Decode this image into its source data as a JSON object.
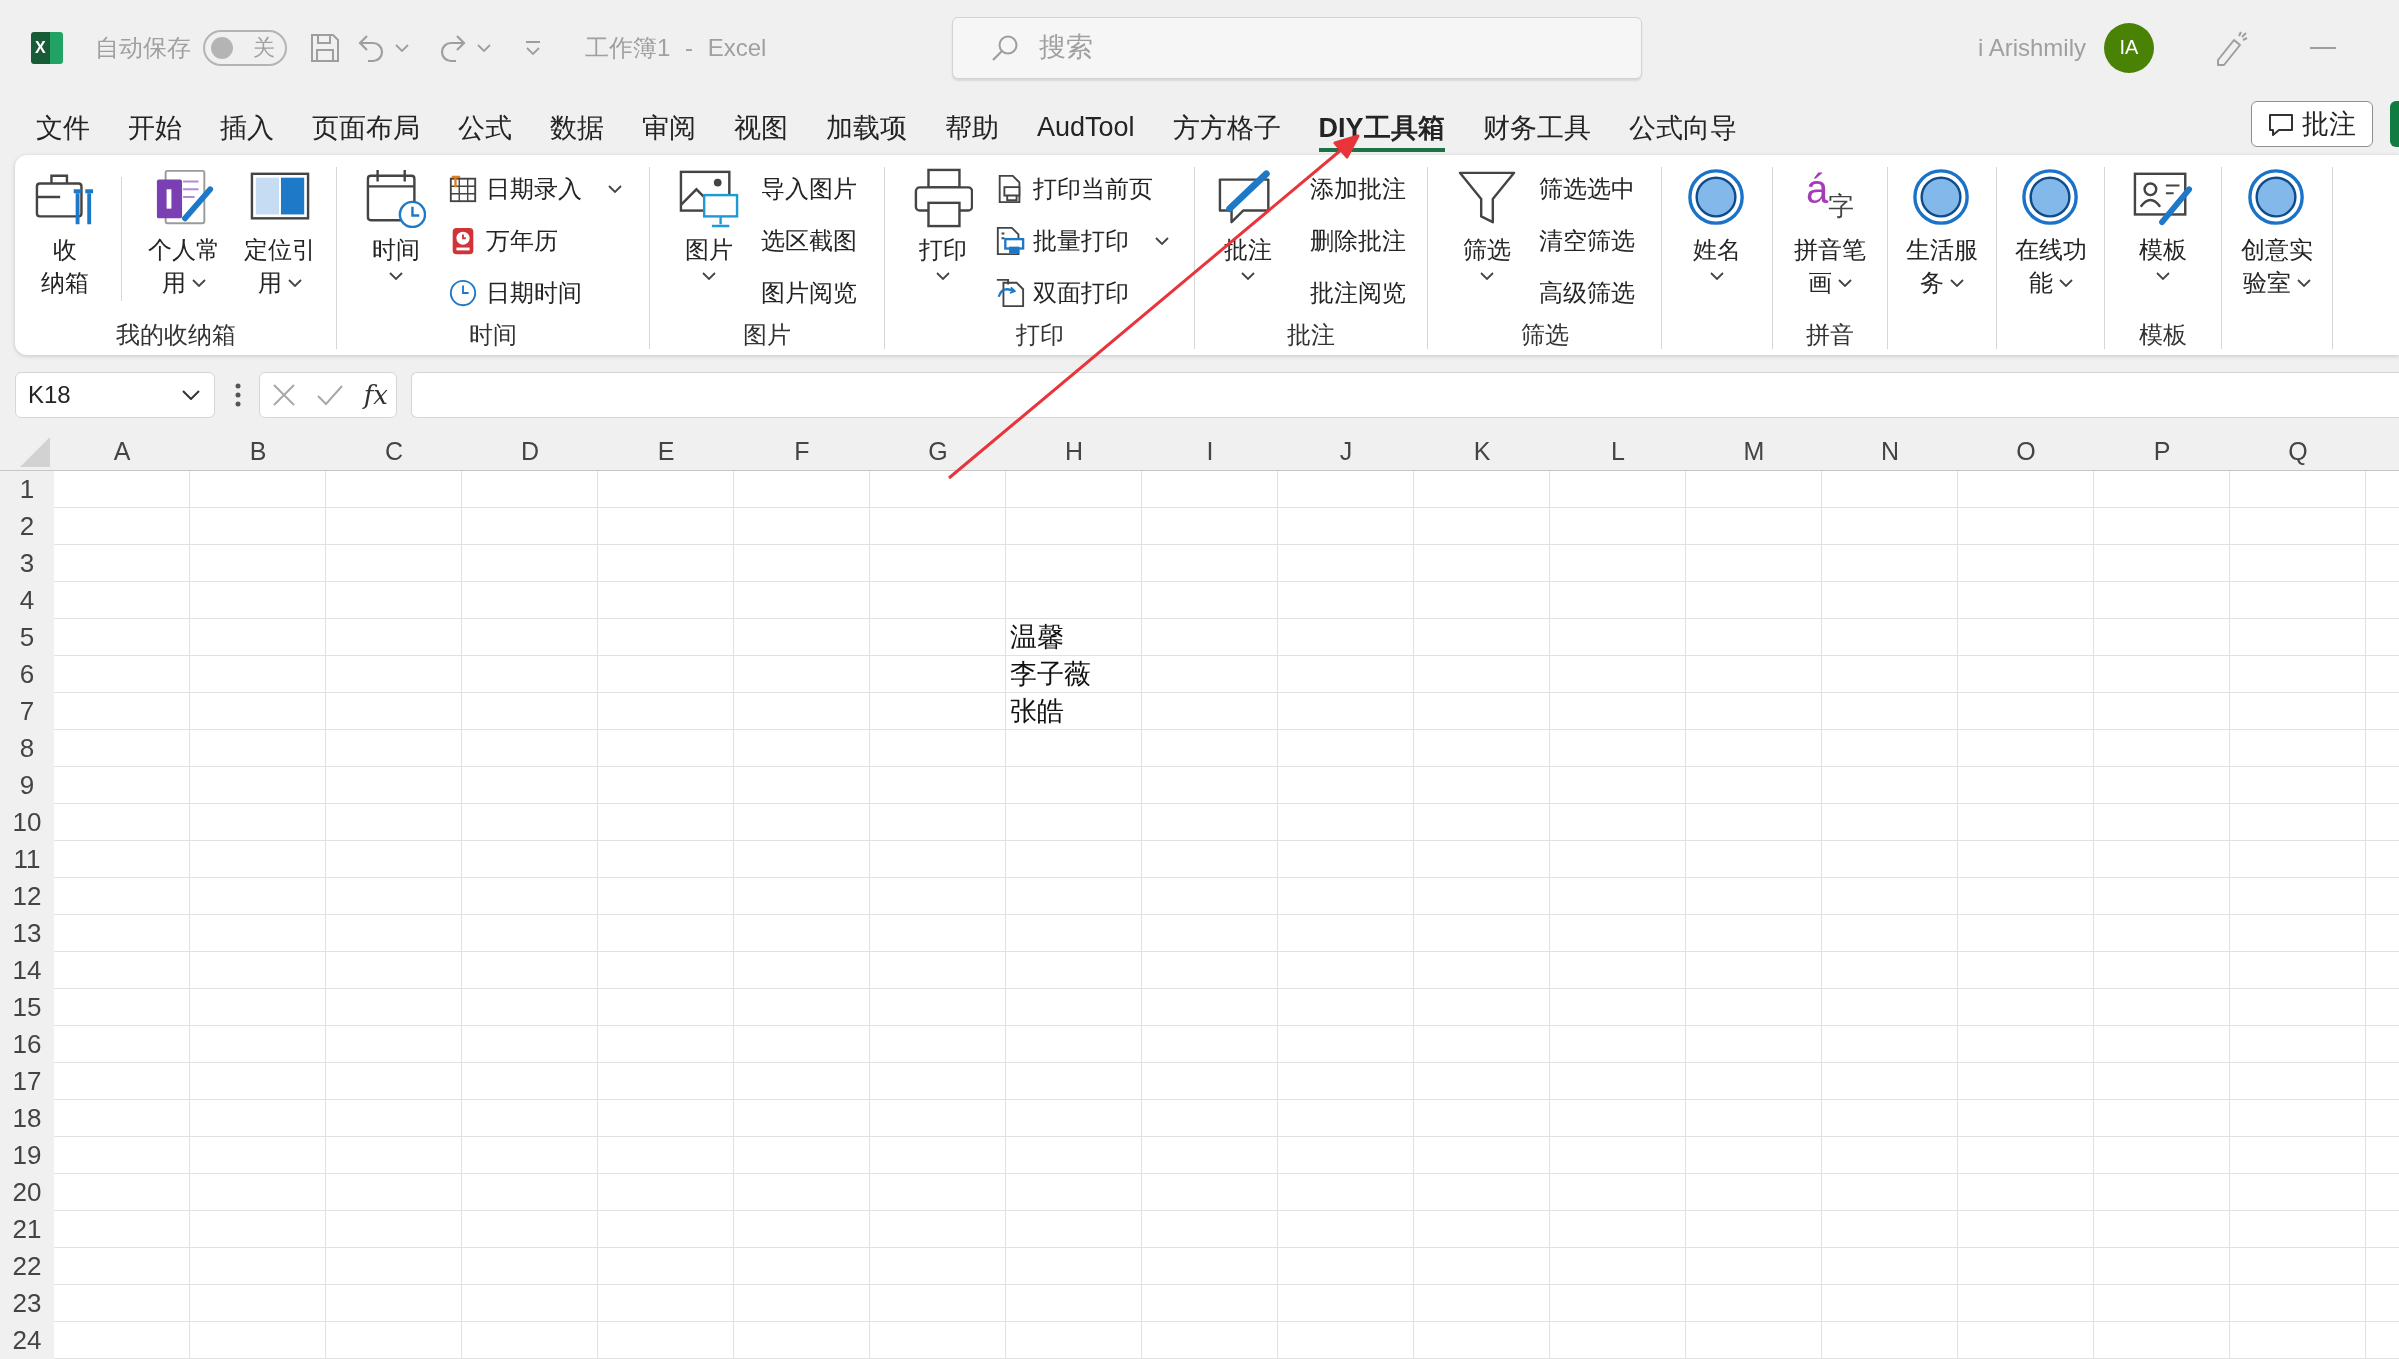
{
  "title_bar": {
    "logo": "X",
    "autosave": {
      "label": "自动保存",
      "state_label": "关",
      "on": false
    },
    "document_title": "工作簿1 - Excel",
    "search": {
      "placeholder": "搜索"
    },
    "user_name": "i Arishmily",
    "avatar_initials": "IA"
  },
  "ribbon_tabs": [
    {
      "label": "文件",
      "selected": false
    },
    {
      "label": "开始",
      "selected": false
    },
    {
      "label": "插入",
      "selected": false
    },
    {
      "label": "页面布局",
      "selected": false
    },
    {
      "label": "公式",
      "selected": false
    },
    {
      "label": "数据",
      "selected": false
    },
    {
      "label": "审阅",
      "selected": false
    },
    {
      "label": "视图",
      "selected": false
    },
    {
      "label": "加载项",
      "selected": false
    },
    {
      "label": "帮助",
      "selected": false
    },
    {
      "label": "AudTool",
      "selected": false
    },
    {
      "label": "方方格子",
      "selected": false
    },
    {
      "label": "DIY工具箱",
      "selected": true
    },
    {
      "label": "财务工具",
      "selected": false
    },
    {
      "label": "公式向导",
      "selected": false
    }
  ],
  "comments_button": {
    "label": "批注"
  },
  "ribbon_groups": [
    {
      "label": "我的收纳箱",
      "items": [
        {
          "kind": "large",
          "label": "收纳箱",
          "dropdown": false
        },
        {
          "kind": "separator"
        },
        {
          "kind": "large",
          "label": "个人常用",
          "dropdown": true
        },
        {
          "kind": "large",
          "label": "定位引用",
          "dropdown": true
        }
      ]
    },
    {
      "label": "时间",
      "items": [
        {
          "kind": "large",
          "label": "时间",
          "dropdown": true
        },
        {
          "kind": "stack",
          "buttons": [
            {
              "label": "日期录入",
              "dropdown": true
            },
            {
              "label": "万年历",
              "dropdown": false
            },
            {
              "label": "日期时间",
              "dropdown": false
            }
          ]
        }
      ]
    },
    {
      "label": "图片",
      "items": [
        {
          "kind": "large",
          "label": "图片",
          "dropdown": true
        },
        {
          "kind": "stack",
          "buttons": [
            {
              "label": "导入图片",
              "dropdown": false
            },
            {
              "label": "选区截图",
              "dropdown": false
            },
            {
              "label": "图片阅览",
              "dropdown": false
            }
          ]
        }
      ]
    },
    {
      "label": "打印",
      "items": [
        {
          "kind": "large",
          "label": "打印",
          "dropdown": true
        },
        {
          "kind": "stack",
          "buttons": [
            {
              "label": "打印当前页",
              "dropdown": false
            },
            {
              "label": "批量打印",
              "dropdown": true
            },
            {
              "label": "双面打印",
              "dropdown": false
            }
          ]
        }
      ]
    },
    {
      "label": "批注",
      "items": [
        {
          "kind": "large",
          "label": "批注",
          "dropdown": true
        },
        {
          "kind": "stack",
          "buttons": [
            {
              "label": "添加批注",
              "dropdown": false
            },
            {
              "label": "删除批注",
              "dropdown": false
            },
            {
              "label": "批注阅览",
              "dropdown": false
            }
          ]
        }
      ]
    },
    {
      "label": "筛选",
      "items": [
        {
          "kind": "large",
          "label": "筛选",
          "dropdown": true
        },
        {
          "kind": "stack",
          "buttons": [
            {
              "label": "筛选选中",
              "dropdown": false
            },
            {
              "label": "清空筛选",
              "dropdown": false
            },
            {
              "label": "高级筛选",
              "dropdown": false
            }
          ]
        }
      ]
    },
    {
      "items": [
        {
          "kind": "large",
          "label": "姓名",
          "dropdown": true
        }
      ]
    },
    {
      "label": "拼音",
      "items": [
        {
          "kind": "large",
          "label": "拼音笔画",
          "dropdown": true,
          "icon_letters": [
            "á",
            "字"
          ]
        }
      ]
    },
    {
      "items": [
        {
          "kind": "large",
          "label": "生活服务",
          "dropdown": true
        }
      ]
    },
    {
      "items": [
        {
          "kind": "large",
          "label": "在线功能",
          "dropdown": true
        }
      ]
    },
    {
      "label": "模板",
      "items": [
        {
          "kind": "large",
          "label": "模板",
          "dropdown": true
        }
      ]
    },
    {
      "items": [
        {
          "kind": "large",
          "label": "创意实验室",
          "dropdown": true
        }
      ]
    }
  ],
  "formula_bar": {
    "name_box": "K18",
    "function_label": "fx"
  },
  "sheet": {
    "columns": [
      "A",
      "B",
      "C",
      "D",
      "E",
      "F",
      "G",
      "H",
      "I",
      "J",
      "K",
      "L",
      "M",
      "N",
      "O",
      "P",
      "Q"
    ],
    "rows": [
      {
        "number": "1"
      },
      {
        "number": "2"
      },
      {
        "number": "3"
      },
      {
        "number": "4"
      },
      {
        "number": "5",
        "cells": {
          "H": "温馨"
        }
      },
      {
        "number": "6",
        "cells": {
          "H": "李子薇"
        }
      },
      {
        "number": "7",
        "cells": {
          "H": "张皓"
        }
      },
      {
        "number": "8"
      },
      {
        "number": "9"
      },
      {
        "number": "10"
      },
      {
        "number": "11"
      },
      {
        "number": "12"
      },
      {
        "number": "13"
      },
      {
        "number": "14"
      },
      {
        "number": "15"
      },
      {
        "number": "16"
      },
      {
        "number": "17"
      },
      {
        "number": "18"
      },
      {
        "number": "19"
      },
      {
        "number": "20"
      },
      {
        "number": "21"
      },
      {
        "number": "22"
      },
      {
        "number": "23"
      },
      {
        "number": "24"
      }
    ]
  }
}
